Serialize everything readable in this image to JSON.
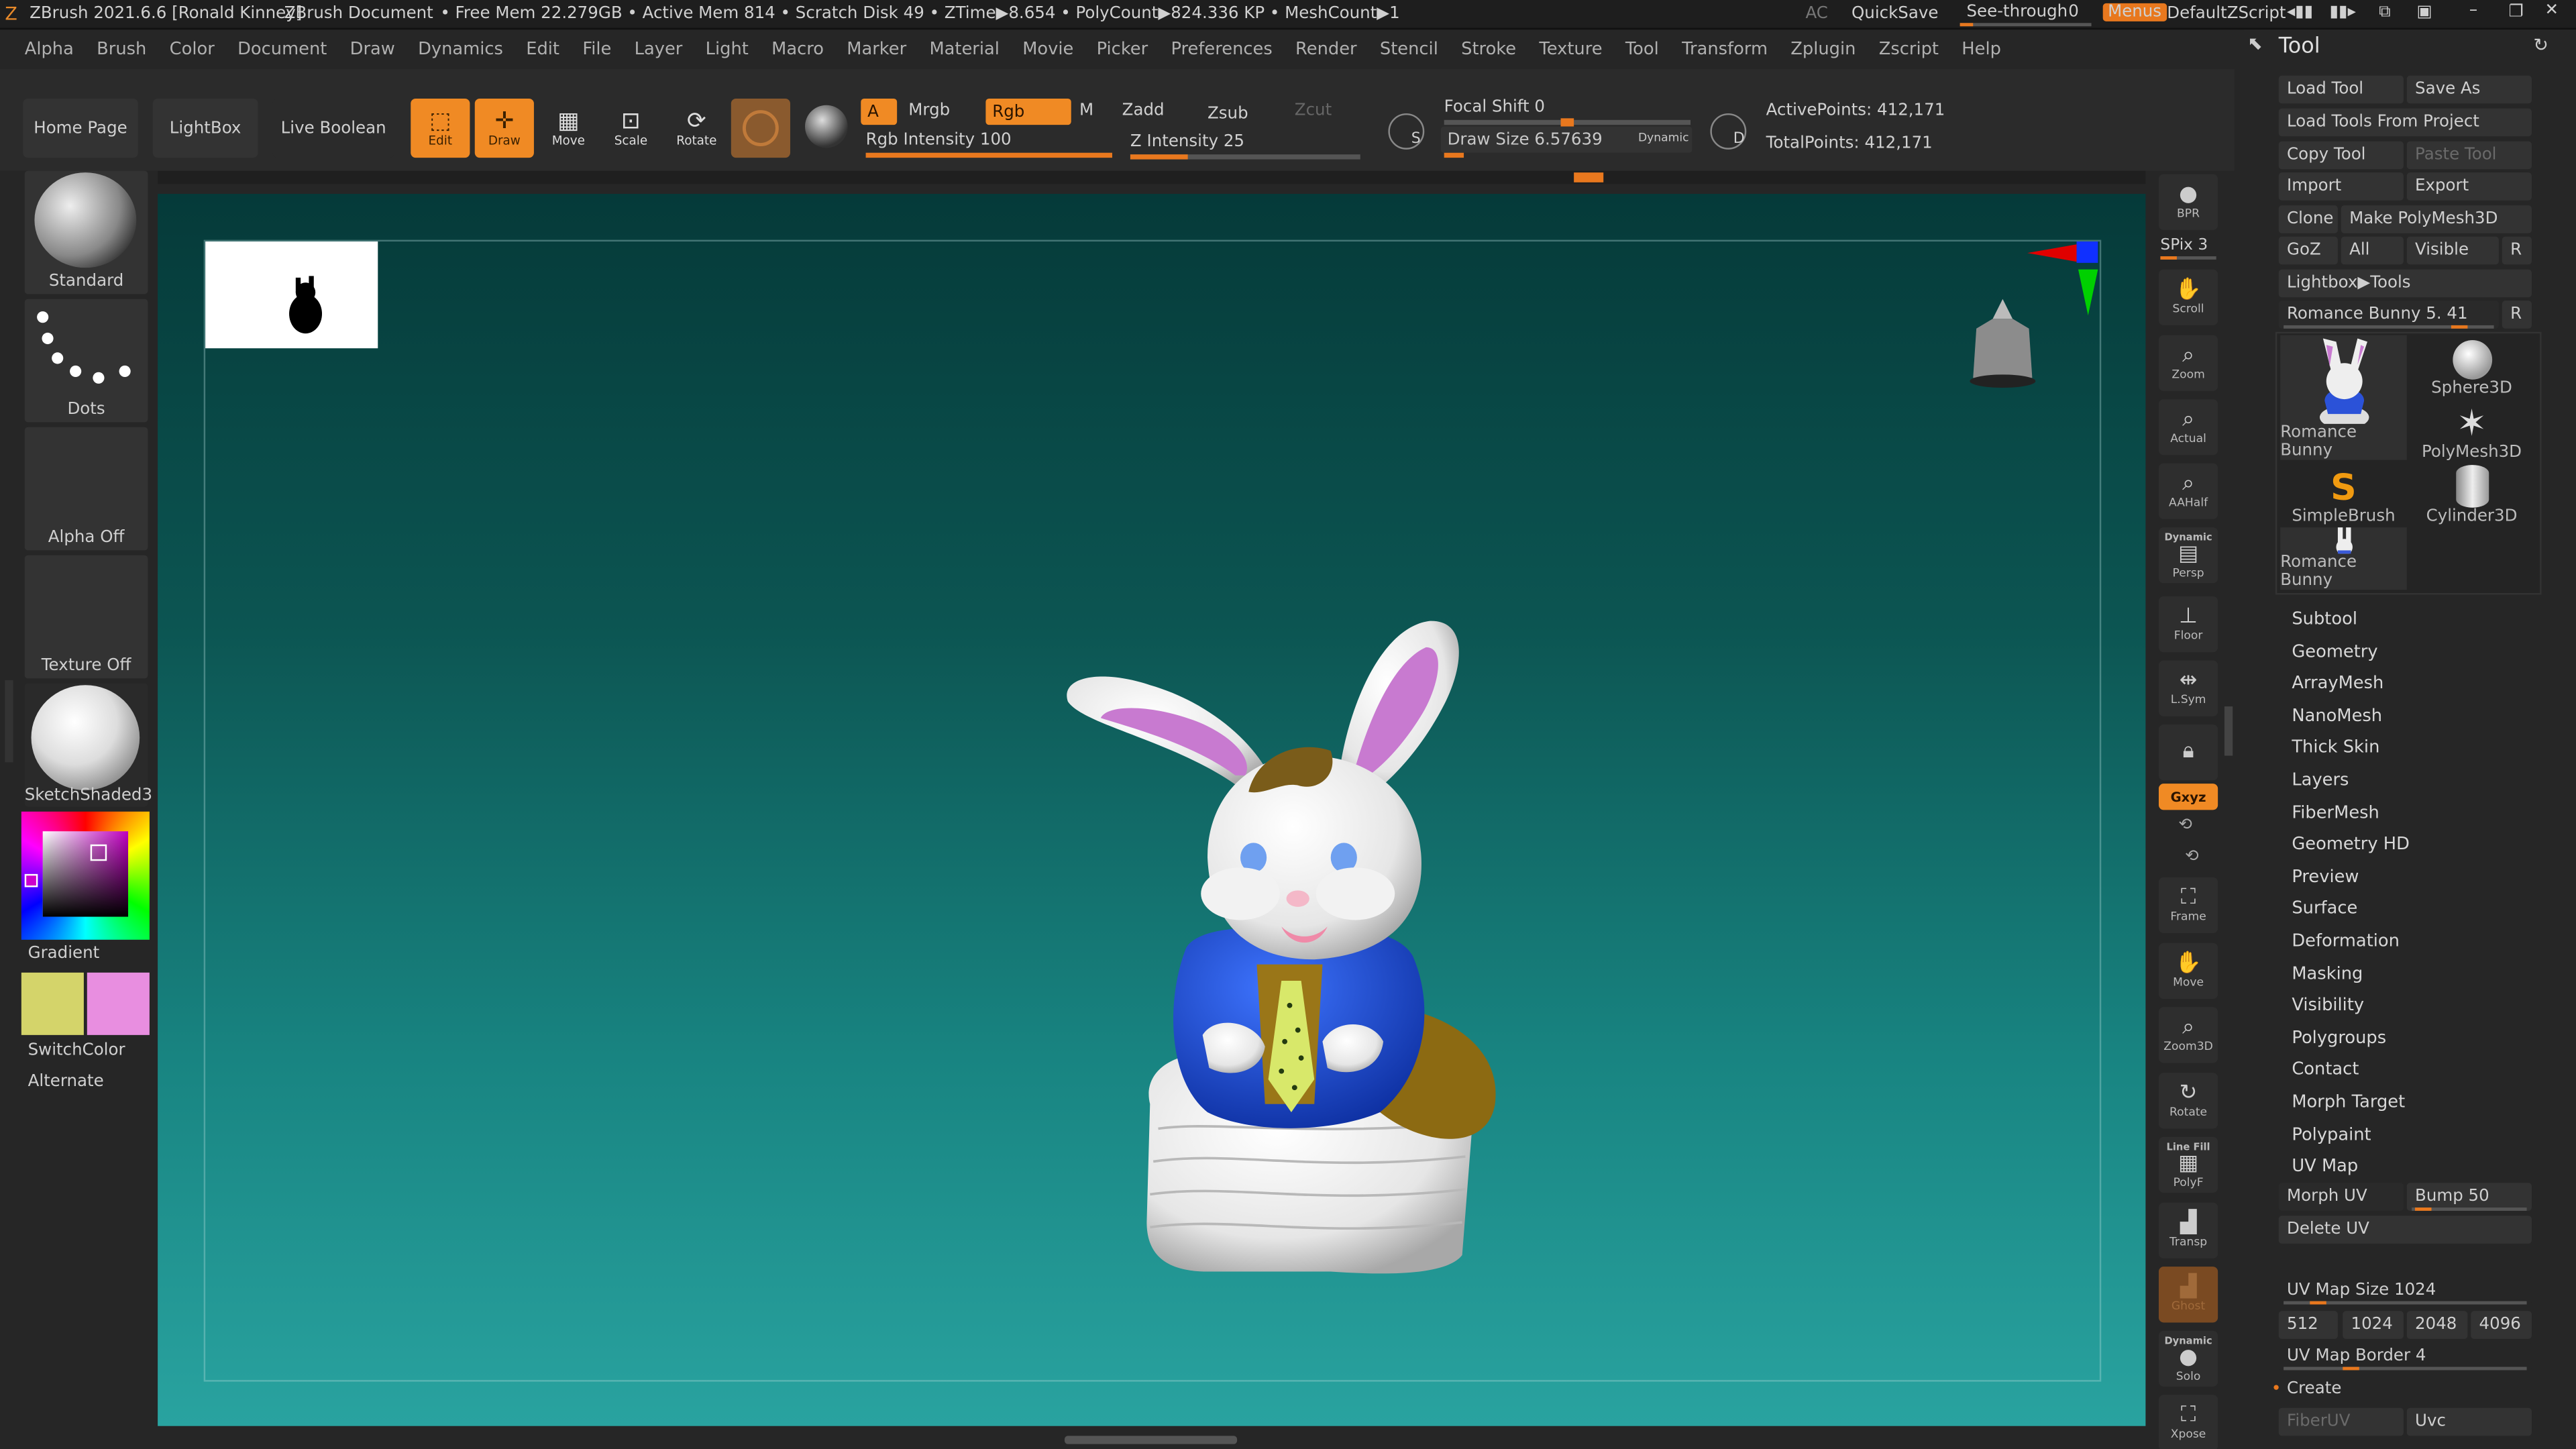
{
  "titlebar": {
    "app": "ZBrush 2021.6.6 [Ronald Kinney]",
    "document": "ZBrush Document",
    "stats": "• Free Mem 22.279GB • Active Mem 814 • Scratch Disk 49 • ZTime▶8.654 • PolyCount▶824.336 KP • MeshCount▶1",
    "ac": "AC",
    "quicksave": "QuickSave",
    "seethrough": "See-through",
    "seethrough_value": "0",
    "menus": "Menus",
    "zscript": "DefaultZScript"
  },
  "menubar": [
    "Alpha",
    "Brush",
    "Color",
    "Document",
    "Draw",
    "Dynamics",
    "Edit",
    "File",
    "Layer",
    "Light",
    "Macro",
    "Marker",
    "Material",
    "Movie",
    "Picker",
    "Preferences",
    "Render",
    "Stencil",
    "Stroke",
    "Texture",
    "Tool",
    "Transform",
    "Zplugin",
    "Zscript",
    "Help"
  ],
  "shelf": {
    "home": "Home Page",
    "lightbox": "LightBox",
    "liveboolean": "Live Boolean",
    "edit": "Edit",
    "draw": "Draw",
    "move": "Move",
    "scale": "Scale",
    "rotate": "Rotate",
    "a": "A",
    "mrgb": "Mrgb",
    "rgb": "Rgb",
    "m": "M",
    "zadd": "Zadd",
    "zsub": "Zsub",
    "zcut": "Zcut",
    "rgb_intensity": "Rgb Intensity 100",
    "z_intensity": "Z Intensity 25",
    "focal_shift": "Focal Shift 0",
    "draw_size": "Draw Size 6.57639",
    "dynamic": "Dynamic",
    "s": "S",
    "d": "D",
    "active_points": "ActivePoints: 412,171",
    "total_points": "TotalPoints: 412,171",
    "rgb_intensity_level": 1.0,
    "z_intensity_level": 0.25,
    "focal_shift_level": 0.5,
    "draw_size_level": 0.08
  },
  "lefttray": {
    "brush": "Standard",
    "stroke": "Dots",
    "alpha": "Alpha Off",
    "texture": "Texture Off",
    "material": "SketchShaded3",
    "gradient": "Gradient",
    "switchcolor": "SwitchColor",
    "alternate": "Alternate",
    "color_main": "#d4d46a",
    "color_secondary": "#e88ee0"
  },
  "righttray": {
    "bpr": "BPR",
    "spix": "SPix 3",
    "scroll": "Scroll",
    "zoom": "Zoom",
    "actual": "Actual",
    "aahalf": "AAHalf",
    "dynamic": "Dynamic",
    "persp": "Persp",
    "floor": "Floor",
    "lsym": "L.Sym",
    "xyz": "Gxyz",
    "frame": "Frame",
    "move": "Move",
    "zoom3d": "Zoom3D",
    "rotate": "Rotate",
    "linefill": "Line Fill",
    "polyf": "PolyF",
    "transp": "Transp",
    "ghost": "Ghost",
    "dynamic2": "Dynamic",
    "solo": "Solo",
    "xpose": "Xpose"
  },
  "toolpanel": {
    "title": "Tool",
    "load_tool": "Load Tool",
    "save_as": "Save As",
    "load_project": "Load Tools From Project",
    "copy_tool": "Copy Tool",
    "paste_tool": "Paste Tool",
    "import": "Import",
    "export": "Export",
    "clone": "Clone",
    "make_polymesh": "Make PolyMesh3D",
    "goz": "GoZ",
    "all": "All",
    "visible": "Visible",
    "r": "R",
    "lightbox_tools": "Lightbox▶Tools",
    "current_tool": "Romance Bunny 5. 41",
    "r2": "R",
    "thumbs": [
      "Romance Bunny",
      "Sphere3D",
      "PolyMesh3D",
      "SimpleBrush",
      "Cylinder3D",
      "Romance Bunny"
    ],
    "subpalettes": [
      "Subtool",
      "Geometry",
      "ArrayMesh",
      "NanoMesh",
      "Thick Skin",
      "Layers",
      "FiberMesh",
      "Geometry HD",
      "Preview",
      "Surface",
      "Deformation",
      "Masking",
      "Visibility",
      "Polygroups",
      "Contact",
      "Morph Target",
      "Polypaint",
      "UV Map"
    ],
    "morph_uv": "Morph UV",
    "bump": "Bump 50",
    "delete_uv": "Delete UV",
    "uv_map_size": "UV Map Size 1024",
    "sizes": [
      "512",
      "1024",
      "2048",
      "4096"
    ],
    "uv_map_border": "UV Map Border 4",
    "create": "Create",
    "fiberuv": "FiberUV",
    "uvc": "Uvc"
  }
}
